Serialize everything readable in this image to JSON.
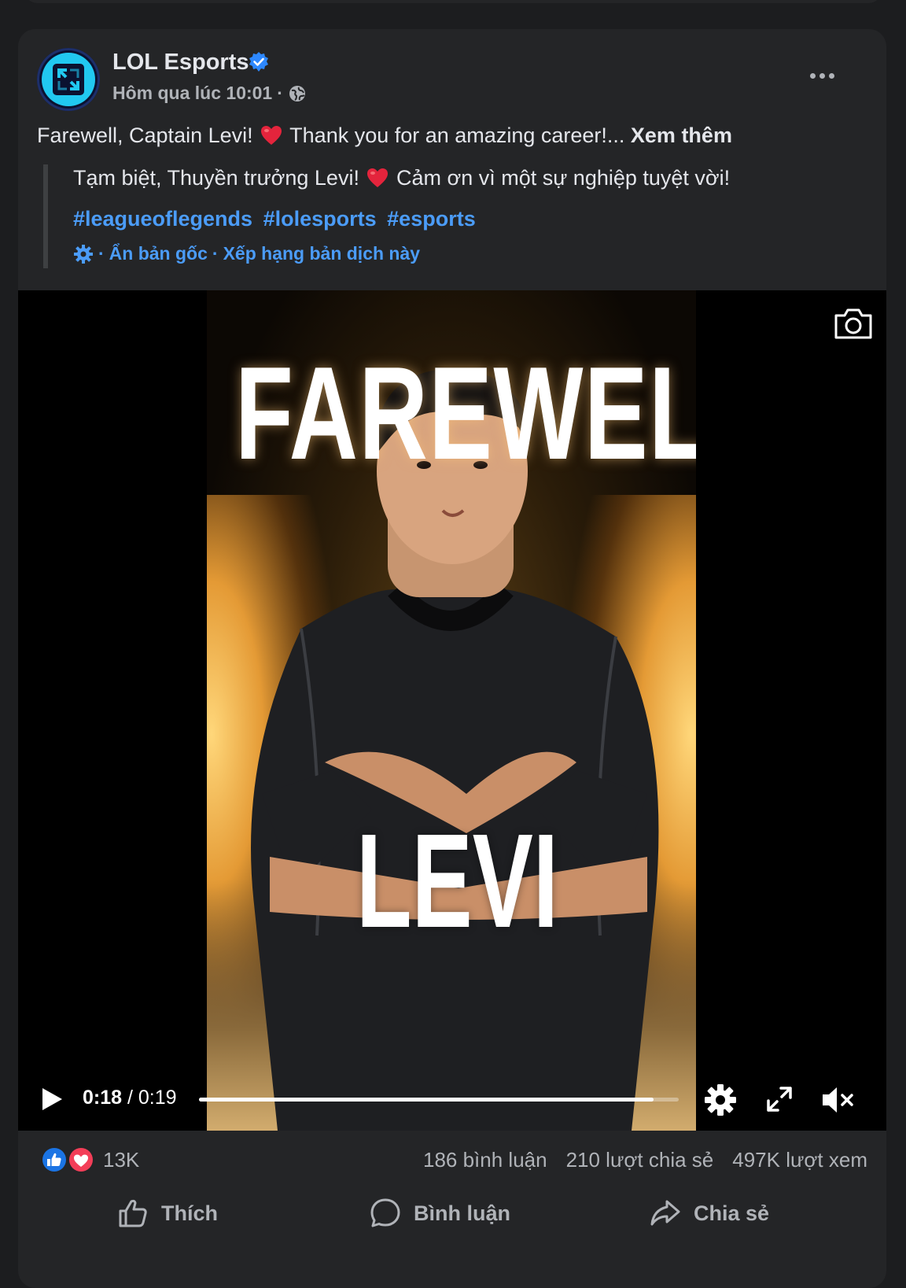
{
  "post": {
    "page_name": "LOL Esports",
    "timestamp": "Hôm qua lúc 10:01",
    "meta_separator": "·",
    "caption_part1": "Farewell, Captain Levi!",
    "caption_part2": "Thank you for an amazing career!...",
    "see_more": "Xem thêm",
    "translation": {
      "text_part1": "Tạm biệt, Thuyền trưởng Levi!",
      "text_part2": "Cảm ơn vì một sự nghiệp tuyệt vời!",
      "hashtags": [
        "#leagueoflegends",
        "#lolesports",
        "#esports"
      ],
      "separator": "·",
      "hide_original": "Ẩn bản gốc",
      "rate_translation": "Xếp hạng bản dịch này"
    }
  },
  "video": {
    "poster_title": "FAREWELL",
    "poster_name": "LEVI",
    "current_time": "0:18",
    "time_separator": " / ",
    "duration": "0:19",
    "progress_fraction": 0.947
  },
  "stats": {
    "reactions": "13K",
    "comments": "186 bình luận",
    "shares": "210 lượt chia sẻ",
    "views": "497K lượt xem"
  },
  "actions": {
    "like": "Thích",
    "comment": "Bình luận",
    "share": "Chia sẻ"
  },
  "colors": {
    "card_bg": "#242527",
    "page_bg": "#1c1d1f",
    "link_blue": "#4b9cf8",
    "verified_blue": "#2d88ff",
    "heart_red": "#e4243c",
    "secondary_text": "#b0b3b8"
  },
  "icons": [
    "lol-esports-logo",
    "verified-badge-icon",
    "globe-icon",
    "more-options-icon",
    "heart-emoji-icon",
    "gear-small-icon",
    "camera-icon",
    "play-icon",
    "settings-gear-icon",
    "fullscreen-icon",
    "mute-icon",
    "like-reaction-icon",
    "love-reaction-icon",
    "thumbs-up-icon",
    "comment-icon",
    "share-icon"
  ]
}
